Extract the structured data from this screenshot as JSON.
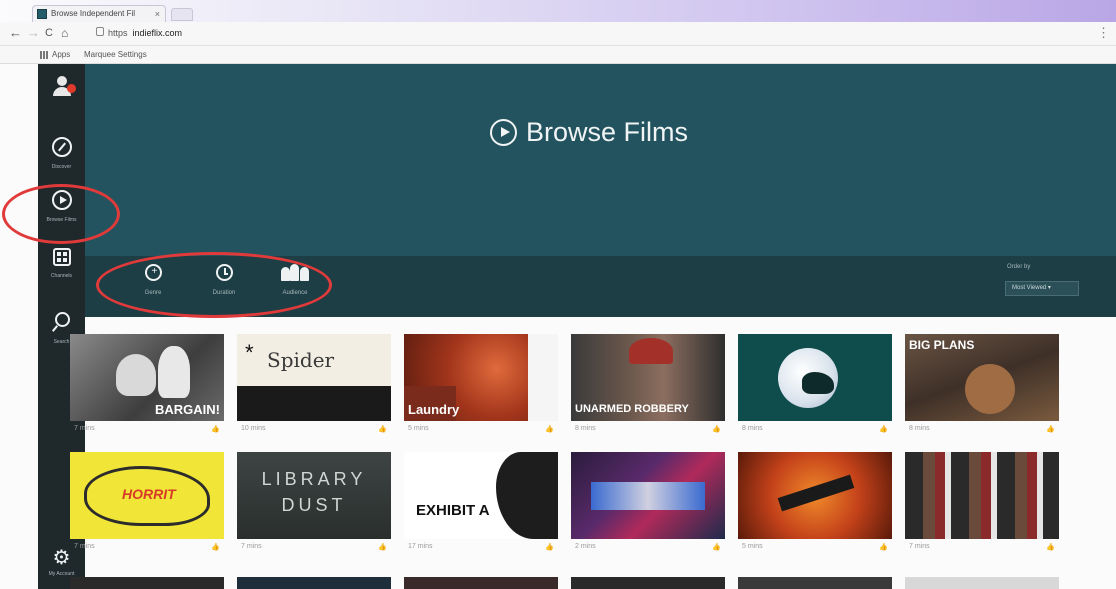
{
  "browser": {
    "tab_title": "Browse Independent Fil",
    "tab_close": "×",
    "window_text": "",
    "nav": {
      "back": "←",
      "forward": "→",
      "reload": "C",
      "home": "⌂"
    },
    "url_scheme": "https",
    "url_host": "indieflix.com",
    "url_path": "",
    "bookmarks": [
      "Apps",
      "Marquee Settings"
    ]
  },
  "sidebar": {
    "items": [
      {
        "label": ""
      },
      {
        "label": "Discover"
      },
      {
        "label": "Browse Films"
      },
      {
        "label": "Channels"
      },
      {
        "label": "Search"
      },
      {
        "label": "My Account"
      }
    ]
  },
  "hero": {
    "title": "Browse Films"
  },
  "filters": {
    "items": [
      {
        "label": "Genre"
      },
      {
        "label": "Duration"
      },
      {
        "label": "Audience"
      }
    ],
    "order_by_label": "Order by",
    "order_by_value": "Most Viewed ▾"
  },
  "colors": {
    "sidebar": "#1f292c",
    "hero": "#23535e",
    "filter_bar": "#1e3e45",
    "highlight": "#e03a3a"
  },
  "films": [
    {
      "title": "BARGAIN!",
      "duration": "7 mins",
      "likes": ""
    },
    {
      "title": "Spider",
      "duration": "10 mins",
      "likes": ""
    },
    {
      "title": "Laundry",
      "duration": "5 mins",
      "likes": ""
    },
    {
      "title": "UNARMED ROBBERY",
      "duration": "8 mins",
      "likes": ""
    },
    {
      "title": "",
      "duration": "8 mins",
      "likes": ""
    },
    {
      "title": "BIG PLANS",
      "duration": "8 mins",
      "likes": ""
    },
    {
      "title": "HORRIT",
      "duration": "7 mins",
      "likes": ""
    },
    {
      "title": "LIBRARY DUST",
      "duration": "7 mins",
      "likes": ""
    },
    {
      "title": "EXHIBIT A",
      "duration": "17 mins",
      "likes": ""
    },
    {
      "title": "",
      "duration": "2 mins",
      "likes": ""
    },
    {
      "title": "",
      "duration": "5 mins",
      "likes": ""
    },
    {
      "title": "",
      "duration": "7 mins",
      "likes": ""
    }
  ]
}
